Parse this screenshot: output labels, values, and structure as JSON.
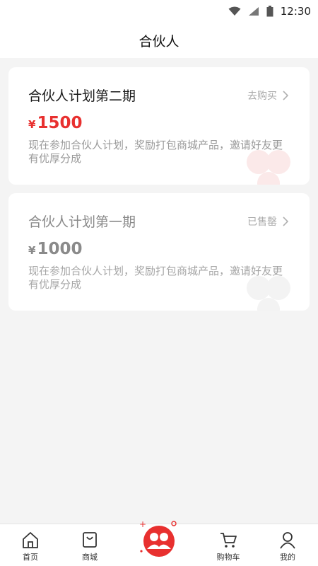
{
  "status_bar": {
    "time": "12:30",
    "icons": [
      "wifi-icon",
      "cell-signal-icon",
      "battery-icon"
    ]
  },
  "header": {
    "title": "合伙人"
  },
  "plans": [
    {
      "title": "合伙人计划第二期",
      "action": "去购买",
      "currency": "¥",
      "price": "1500",
      "description": "现在参加合伙人计划，奖励打包商城产品，邀请好友更有优厚分成",
      "status": "active"
    },
    {
      "title": "合伙人计划第一期",
      "action": "已售罄",
      "currency": "¥",
      "price": "1000",
      "description": "现在参加合伙人计划，奖励打包商城产品，邀请好友更有优厚分成",
      "status": "sold-out"
    }
  ],
  "tabbar": {
    "items": [
      {
        "label": "首页",
        "icon": "home-icon"
      },
      {
        "label": "商城",
        "icon": "shopping-bag-icon"
      },
      {
        "label": "",
        "icon": "partner-icon"
      },
      {
        "label": "购物车",
        "icon": "cart-icon"
      },
      {
        "label": "我的",
        "icon": "user-icon"
      }
    ]
  },
  "colors": {
    "accent": "#e8302f",
    "background": "#f4f4f4",
    "muted_text": "#9a9a9a"
  }
}
